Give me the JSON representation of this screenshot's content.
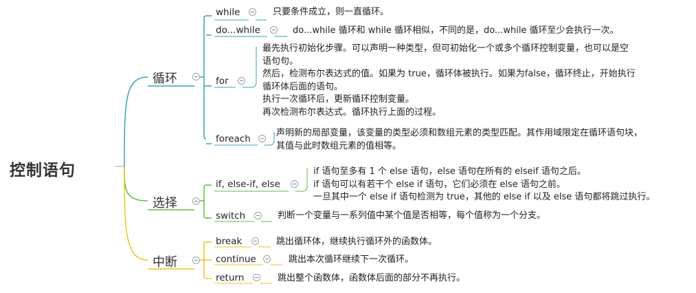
{
  "root": {
    "label": "控制语句"
  },
  "colors": {
    "loop": "#2aa7b9",
    "select": "#5bbf3c",
    "interrupt": "#f1c40f"
  },
  "branches": {
    "loop": {
      "label": "循环",
      "items": [
        {
          "label": "while",
          "desc": [
            "只要条件成立，则一直循环。"
          ]
        },
        {
          "label": "do...while",
          "desc": [
            "do...while 循环和 while 循环相似，不同的是，do...while 循环至少会执行一次。"
          ]
        },
        {
          "label": "for",
          "desc": [
            "最先执行初始化步骤。可以声明一种类型，但可初始化一个或多个循环控制变量，也可以是空",
            "语句句。",
            "然后，检测布尔表达式的值。如果为 true，循环体被执行。如果为false，循环终止，开始执行",
            "循环体后面的语句。",
            "执行一次循环后，更新循环控制变量。",
            "再次检测布尔表达式。循环执行上面的过程。"
          ]
        },
        {
          "label": "foreach",
          "desc": [
            "声明新的局部变量，该变量的类型必须和数组元素的类型匹配。其作用域限定在循环语句块，",
            "其值与此时数组元素的值相等。"
          ]
        }
      ]
    },
    "select": {
      "label": "选择",
      "items": [
        {
          "label": "if, else-if, else",
          "desc": [
            "if 语句至多有 1 个 else 语句，else 语句在所有的 elseif 语句之后。",
            "if 语句可以有若干个 else if 语句，它们必须在 else 语句之前。",
            "一旦其中一个 else if 语句检测为 true，其他的 else if 以及 else 语句都将跳过执行。"
          ]
        },
        {
          "label": "switch",
          "desc": [
            "判断一个变量与一系列值中某个值是否相等，每个值称为一个分支。"
          ]
        }
      ]
    },
    "interrupt": {
      "label": "中断",
      "items": [
        {
          "label": "break",
          "desc": [
            "跳出循环体，继续执行循环外的函数体。"
          ]
        },
        {
          "label": "continue",
          "desc": [
            "跳出本次循环继续下一次循环。"
          ]
        },
        {
          "label": "return",
          "desc": [
            "跳出整个函数体，函数体后面的部分不再执行。"
          ]
        }
      ]
    }
  }
}
